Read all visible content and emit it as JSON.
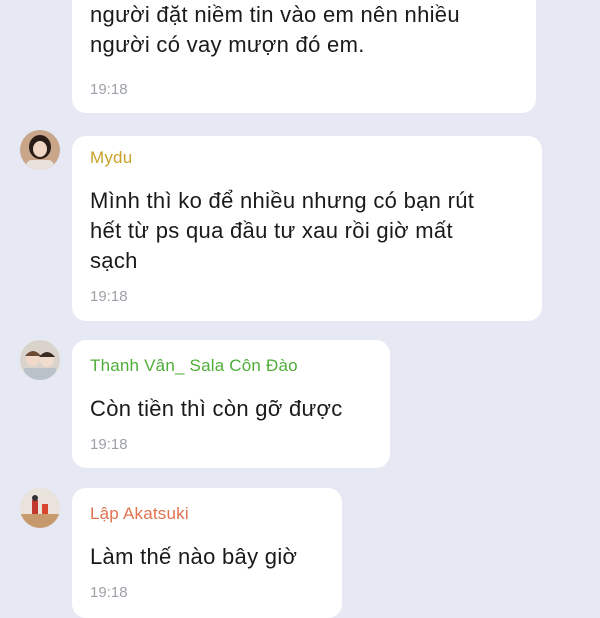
{
  "messages": [
    {
      "sender": "",
      "lines": [
        "người đặt niềm tin vào em nên nhiều",
        "người có vay mượn đó em."
      ],
      "time": "19:18"
    },
    {
      "sender": "Mydu",
      "sender_color": "#c9a227",
      "lines": [
        "Mình thì ko để nhiều nhưng có bạn rút",
        "hết từ ps qua đầu tư xau rồi giờ mất",
        "sạch"
      ],
      "time": "19:18"
    },
    {
      "sender": "Thanh Vân_ Sala Côn Đào",
      "sender_color": "#4fae3a",
      "lines": [
        "Còn tiền thì còn gỡ được"
      ],
      "time": "19:18"
    },
    {
      "sender": "Lập Akatsuki",
      "sender_color": "#e0724f",
      "lines": [
        "Làm thế nào bây giờ"
      ],
      "time": "19:18"
    }
  ],
  "colors": {
    "background": "#e6e8f3",
    "bubble": "#ffffff",
    "time": "#9da1a8"
  }
}
